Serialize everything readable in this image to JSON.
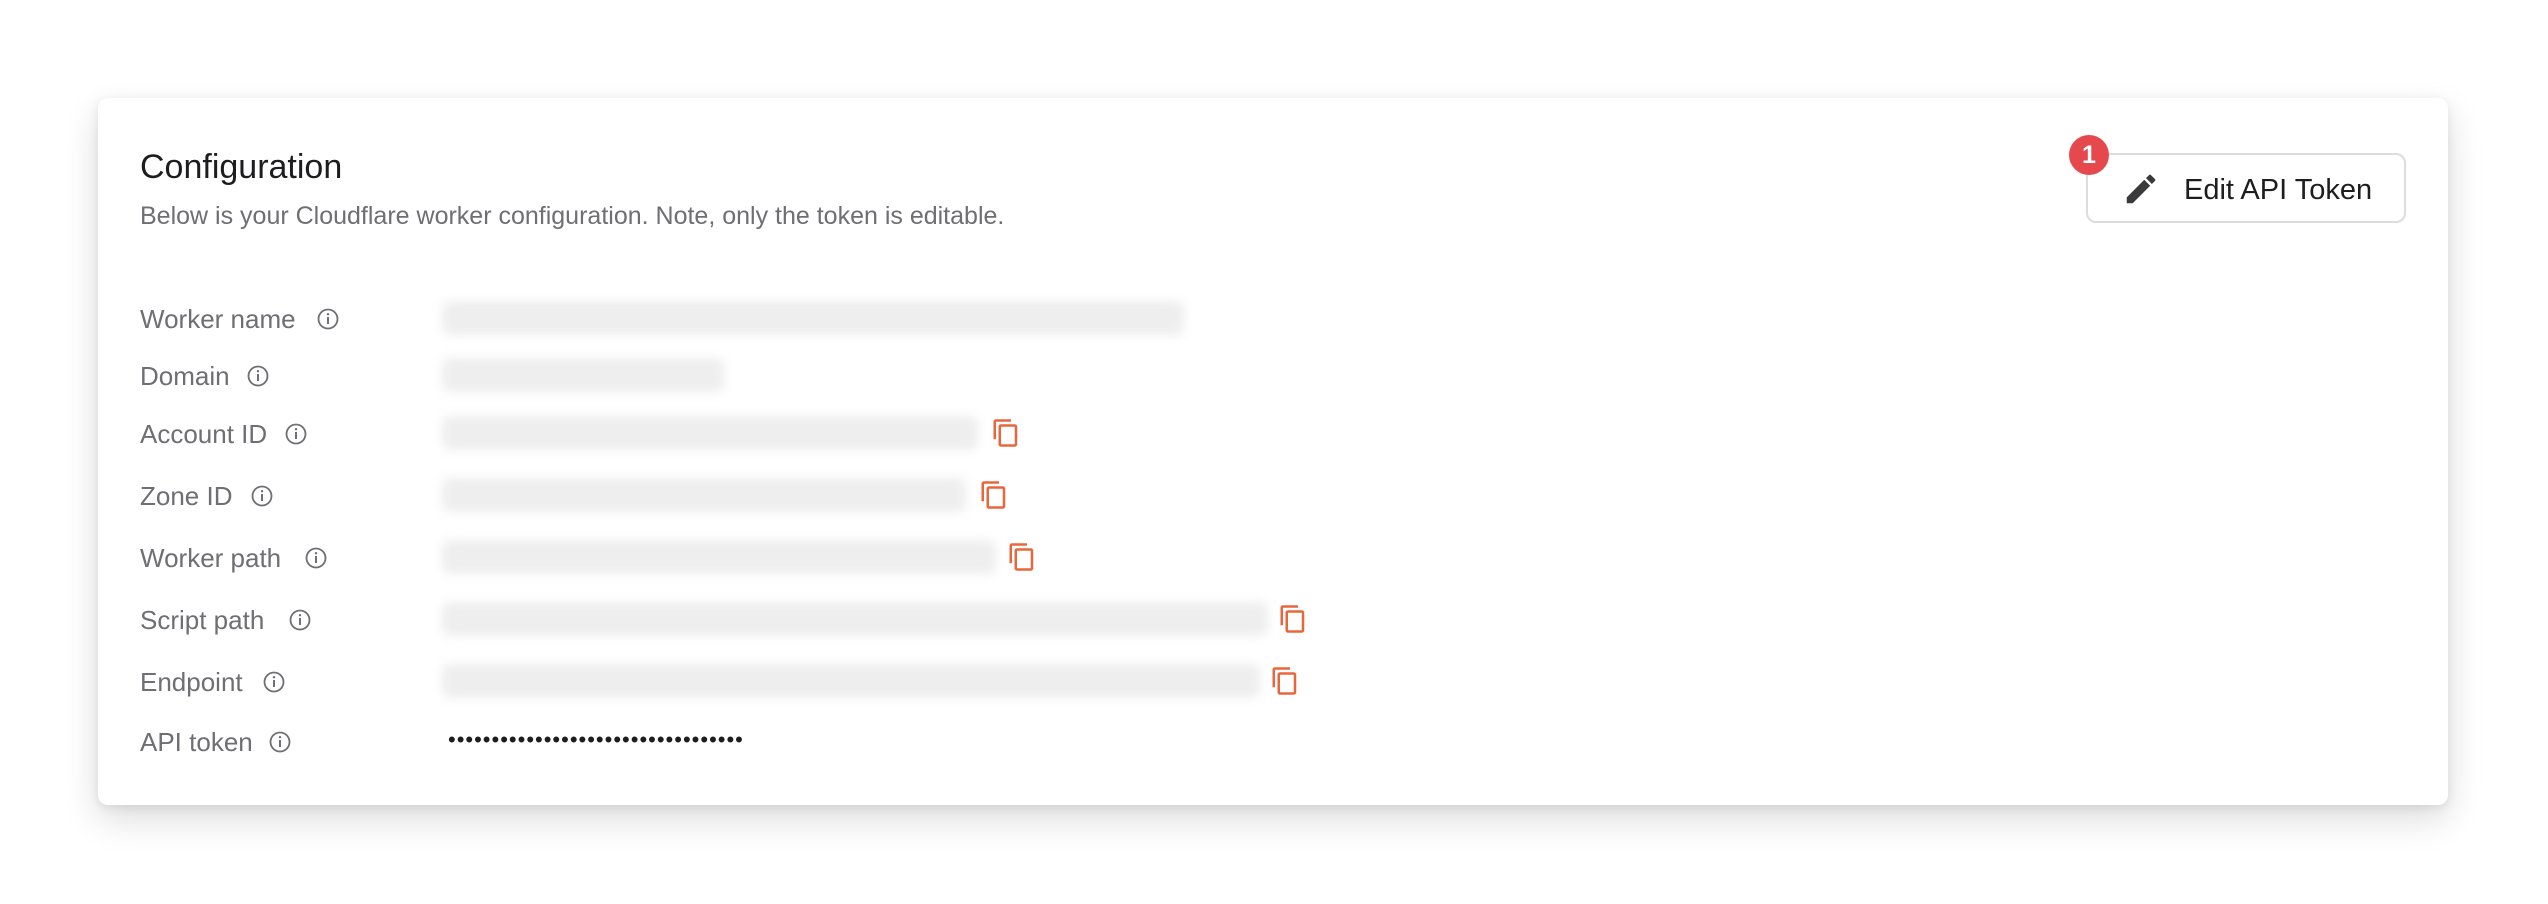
{
  "config": {
    "title": "Configuration",
    "subtitle": "Below is your Cloudflare worker configuration. Note, only the token is editable.",
    "edit_button_label": "Edit API Token",
    "badge_count": "1",
    "fields": {
      "worker_name": {
        "label": "Worker name",
        "value": "blurred"
      },
      "domain": {
        "label": "Domain",
        "value": "blurred"
      },
      "account_id": {
        "label": "Account ID",
        "value": "blurred"
      },
      "zone_id": {
        "label": "Zone ID",
        "value": "blurred"
      },
      "worker_path": {
        "label": "Worker path",
        "value": "blurred"
      },
      "script_path": {
        "label": "Script path",
        "value": "blurred"
      },
      "endpoint": {
        "label": "Endpoint",
        "value": "blurred"
      },
      "api_token": {
        "label": "API token",
        "value": "••••••••••••••••••••••••••••••••••"
      }
    }
  },
  "colors": {
    "accent_copy": "#e8663c",
    "badge": "#e5484d",
    "label_text": "#6e6e73",
    "title_text": "#1d1d1f"
  },
  "icons": {
    "edit": "pencil-icon",
    "info": "info-icon",
    "copy": "copy-icon"
  }
}
